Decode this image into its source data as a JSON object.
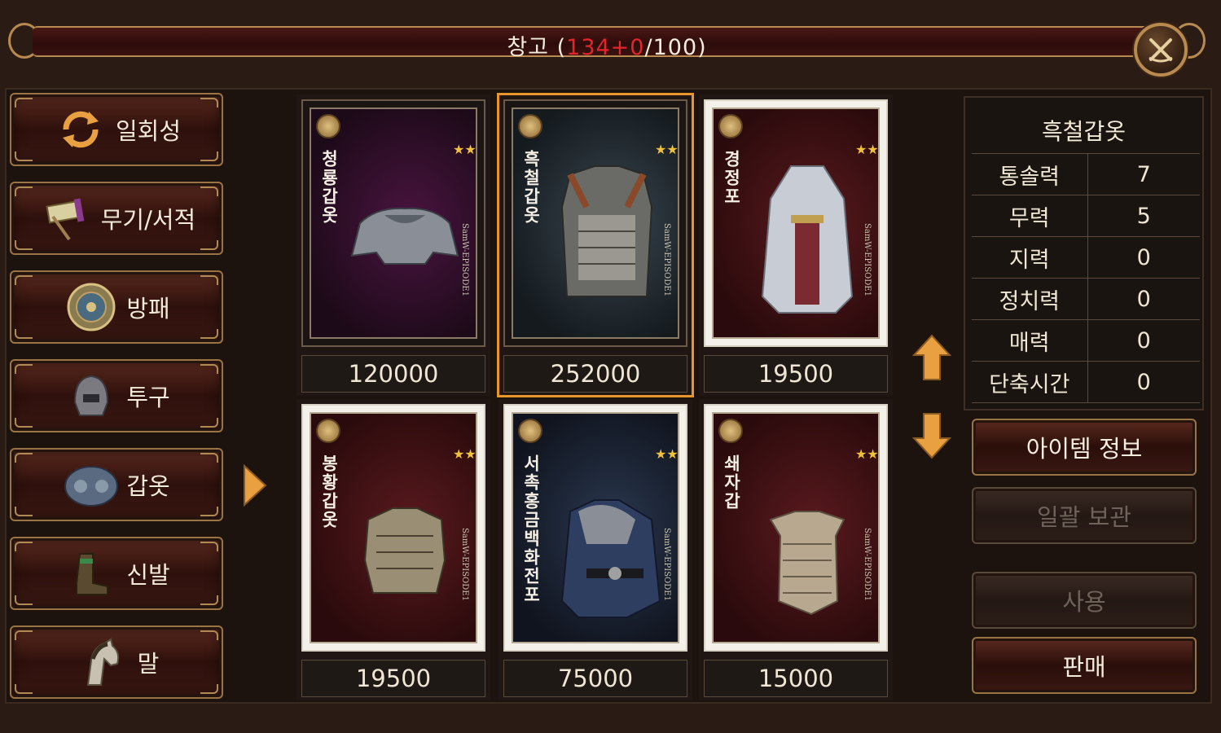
{
  "header": {
    "title_prefix": "창고 (",
    "count_used": "134+0",
    "title_suffix": "/100)"
  },
  "sidebar": {
    "items": [
      {
        "label": "일회성",
        "icon": "refresh-icon"
      },
      {
        "label": "무기/서적",
        "icon": "weapon-book-icon"
      },
      {
        "label": "방패",
        "icon": "shield-icon"
      },
      {
        "label": "투구",
        "icon": "helmet-icon"
      },
      {
        "label": "갑옷",
        "icon": "armor-icon"
      },
      {
        "label": "신발",
        "icon": "boots-icon"
      },
      {
        "label": "말",
        "icon": "horse-icon"
      }
    ],
    "active": "갑옷"
  },
  "items": [
    {
      "name": "청룡갑옷",
      "stars": "★★★",
      "tag": "SamW-EPISODE1",
      "price": "120000",
      "frame": "dark",
      "bg": "purple",
      "selected": false
    },
    {
      "name": "흑철갑옷",
      "stars": "★★★",
      "tag": "SamW-EPISODE1",
      "price": "252000",
      "frame": "dark",
      "bg": "steel",
      "selected": true
    },
    {
      "name": "경정포",
      "stars": "★★",
      "tag": "SamW-EPISODE1",
      "price": "19500",
      "frame": "light",
      "bg": "red",
      "selected": false
    },
    {
      "name": "봉황갑옷",
      "stars": "★★",
      "tag": "SamW-EPISODE1",
      "price": "19500",
      "frame": "light",
      "bg": "red",
      "selected": false
    },
    {
      "name": "서촉홍금백화전포",
      "stars": "★★",
      "tag": "SamW-EPISODE1",
      "price": "75000",
      "frame": "light",
      "bg": "blue",
      "selected": false
    },
    {
      "name": "쇄자갑",
      "stars": "★★",
      "tag": "SamW-EPISODE1",
      "price": "15000",
      "frame": "light",
      "bg": "red",
      "selected": false
    }
  ],
  "detail": {
    "name": "흑철갑옷",
    "stats": [
      {
        "label": "통솔력",
        "value": "7"
      },
      {
        "label": "무력",
        "value": "5"
      },
      {
        "label": "지력",
        "value": "0"
      },
      {
        "label": "정치력",
        "value": "0"
      },
      {
        "label": "매력",
        "value": "0"
      },
      {
        "label": "단축시간",
        "value": "0"
      }
    ]
  },
  "actions": {
    "item_info": "아이템 정보",
    "bulk_store": "일괄 보관",
    "use": "사용",
    "sell": "판매"
  },
  "colors": {
    "accent_gold": "#b88a4f",
    "selected_outline": "#e8962a",
    "count_red": "#e3242b",
    "star": "#f0c23a"
  }
}
